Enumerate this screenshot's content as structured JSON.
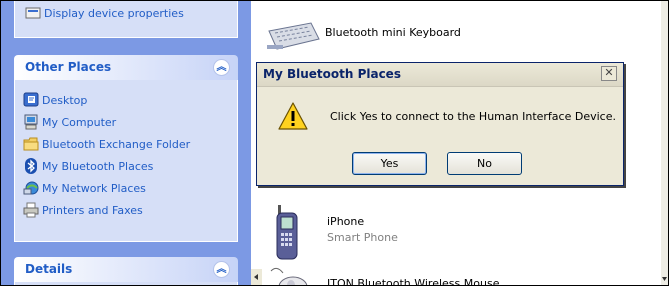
{
  "left_pane": {
    "top_link": "Display device properties",
    "other_places": {
      "title": "Other Places",
      "items": [
        {
          "label": "Desktop",
          "icon": "desktop-icon"
        },
        {
          "label": "My Computer",
          "icon": "my-computer-icon"
        },
        {
          "label": "Bluetooth Exchange Folder",
          "icon": "folder-icon"
        },
        {
          "label": "My Bluetooth Places",
          "icon": "bluetooth-icon"
        },
        {
          "label": "My Network Places",
          "icon": "network-places-icon"
        },
        {
          "label": "Printers and Faxes",
          "icon": "printer-icon"
        }
      ]
    },
    "details": {
      "title": "Details"
    }
  },
  "devices": [
    {
      "name": "Bluetooth mini Keyboard",
      "sub": "",
      "icon": "keyboard-icon"
    },
    {
      "name": "iPhone",
      "sub": "Smart Phone",
      "icon": "phone-icon"
    },
    {
      "name": "ITON Bluetooth Wireless Mouse",
      "sub": "",
      "icon": "mouse-icon"
    }
  ],
  "dialog": {
    "title": "My Bluetooth Places",
    "message": "Click Yes to connect to the Human Interface Device.",
    "yes_label": "Yes",
    "no_label": "No",
    "icon": "warning-icon"
  },
  "colors": {
    "task_pane_bg": "#7c99e4",
    "panel_body": "#d6dff7",
    "link_blue": "#215dc6",
    "dialog_bg": "#ece9d8"
  }
}
